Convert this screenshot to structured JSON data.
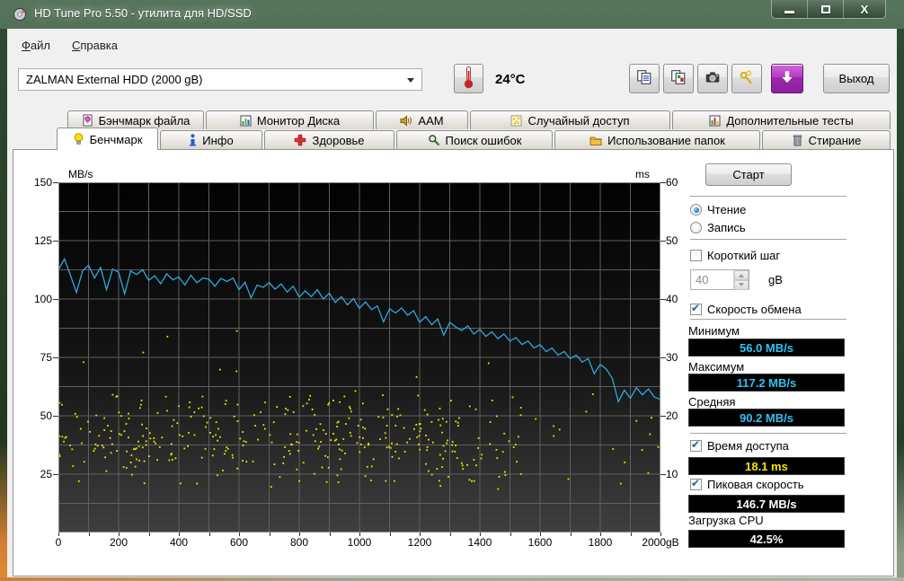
{
  "window": {
    "title": "HD Tune Pro 5.50 - утилита для HD/SSD",
    "controls": [
      {
        "name": "minimize"
      },
      {
        "name": "maximize"
      },
      {
        "name": "close"
      }
    ]
  },
  "menu": {
    "items": [
      "Файл",
      "Справка"
    ]
  },
  "toolbar": {
    "drive_select": "ZALMAN  External HDD (2000 gB)",
    "temperature": "24°C",
    "buttons": [
      {
        "name": "copy-text",
        "icon": "copy-text-icon"
      },
      {
        "name": "copy-image",
        "icon": "copy-image-icon"
      },
      {
        "name": "screenshot",
        "icon": "camera-icon"
      },
      {
        "name": "options",
        "icon": "options-icon"
      }
    ],
    "save_button": {
      "name": "save-results",
      "icon": "save-arrow-icon"
    },
    "exit_label": "Выход"
  },
  "tabs": {
    "row1": [
      {
        "name": "file-benchmark",
        "icon": "file-bulb-icon",
        "label": "Бэнчмарк файла"
      },
      {
        "name": "disk-monitor",
        "icon": "disk-monitor-icon",
        "label": "Монитор Диска"
      },
      {
        "name": "aam",
        "icon": "speaker-icon",
        "label": "AAM"
      },
      {
        "name": "random-access",
        "icon": "random-access-icon",
        "label": "Случайный доступ"
      },
      {
        "name": "extra-tests",
        "icon": "additional-tests-icon",
        "label": "Дополнительные  тесты"
      }
    ],
    "row2": [
      {
        "name": "benchmark",
        "icon": "bulb-icon",
        "label": "Бенчмарк",
        "selected": true
      },
      {
        "name": "info",
        "icon": "info-icon",
        "label": "Инфо",
        "selected": false
      },
      {
        "name": "health",
        "icon": "health-icon",
        "label": "Здоровье",
        "selected": false
      },
      {
        "name": "error-scan",
        "icon": "error-scan-icon",
        "label": "Поиск ошибок",
        "selected": false
      },
      {
        "name": "folder-usage",
        "icon": "folder-icon",
        "label": "Использование папок",
        "selected": false
      },
      {
        "name": "erase",
        "icon": "erase-icon",
        "label": "Стирание",
        "selected": false
      }
    ]
  },
  "chart_data": {
    "type": "line+scatter",
    "x_range_gb": [
      0,
      2000
    ],
    "x_tick_labels": [
      "0",
      "200",
      "400",
      "600",
      "800",
      "1000",
      "1200",
      "1400",
      "1600",
      "1800",
      "2000gB"
    ],
    "left_axis": {
      "label": "MB/s",
      "range": [
        0,
        150
      ],
      "ticks": [
        150,
        125,
        100,
        75,
        50,
        25
      ]
    },
    "right_axis": {
      "label": "ms",
      "range": [
        0,
        60
      ],
      "ticks": [
        60,
        50,
        40,
        30,
        20,
        10
      ]
    },
    "grid": {
      "vertical_every_gb": 100,
      "horizontal_every_mbs": 12.5
    },
    "line_color": "#2FA8DC",
    "scatter_color": "#E8E800",
    "series": [
      {
        "name": "transfer-rate-mbs",
        "x_step_gb": 20,
        "values": [
          112.5,
          117.2,
          110.2,
          102.8,
          112.0,
          114.5,
          109.0,
          113.5,
          104.0,
          112.8,
          111.5,
          102.2,
          112.0,
          110.5,
          112.5,
          108.0,
          110.0,
          106.5,
          110.8,
          108.2,
          109.5,
          106.0,
          110.2,
          107.0,
          109.0,
          108.5,
          105.5,
          108.8,
          107.5,
          109.0,
          104.0,
          107.2,
          100.5,
          106.0,
          105.0,
          107.0,
          104.2,
          106.5,
          103.0,
          105.5,
          100.8,
          103.5,
          101.0,
          104.0,
          100.0,
          102.5,
          98.5,
          101.0,
          97.5,
          100.2,
          96.0,
          98.8,
          95.5,
          97.0,
          90.2,
          95.8,
          94.0,
          96.2,
          93.0,
          95.0,
          90.0,
          92.5,
          89.0,
          91.5,
          84.5,
          90.0,
          88.0,
          86.5,
          88.5,
          85.0,
          87.0,
          84.0,
          86.0,
          83.0,
          85.0,
          82.0,
          83.5,
          80.5,
          82.0,
          79.0,
          80.5,
          77.5,
          79.0,
          76.0,
          77.5,
          74.5,
          76.0,
          73.0,
          74.5,
          68.0,
          72.0,
          70.0,
          66.0,
          56.0,
          61.0,
          57.5,
          62.0,
          59.0,
          61.5,
          58.0,
          57.0
        ]
      },
      {
        "name": "access-time-scatter-ms",
        "generated": {
          "seed": 7,
          "count": 390,
          "ms_min": 7,
          "ms_max": 25,
          "dense_until_gb": 1540,
          "dense_fraction": 0.93
        }
      }
    ]
  },
  "panel": {
    "start_label": "Старт",
    "mode": {
      "options": [
        {
          "label": "Чтение",
          "selected": true
        },
        {
          "label": "Запись",
          "selected": false
        }
      ]
    },
    "short_stride": {
      "label": "Короткий шаг",
      "checked": false,
      "value": "40",
      "unit": "gB"
    },
    "transfer": {
      "label": "Скорость обмена",
      "checked": true,
      "stats": [
        {
          "label": "Минимум",
          "value": "56.0 MB/s",
          "color": "#2EC4F5"
        },
        {
          "label": "Максимум",
          "value": "117.2 MB/s",
          "color": "#2EC4F5"
        },
        {
          "label": "Средняя",
          "value": "90.2 MB/s",
          "color": "#2EC4F5"
        }
      ]
    },
    "access_time": {
      "label": "Время доступа",
      "checked": true,
      "value": "18.1 ms",
      "color": "#F5E400"
    },
    "burst_rate": {
      "label": "Пиковая скорость",
      "checked": true,
      "value": "146.7 MB/s",
      "color": "#FFFFFF"
    },
    "cpu": {
      "label": "Загрузка CPU",
      "value": "42.5%",
      "color": "#FFFFFF"
    }
  }
}
